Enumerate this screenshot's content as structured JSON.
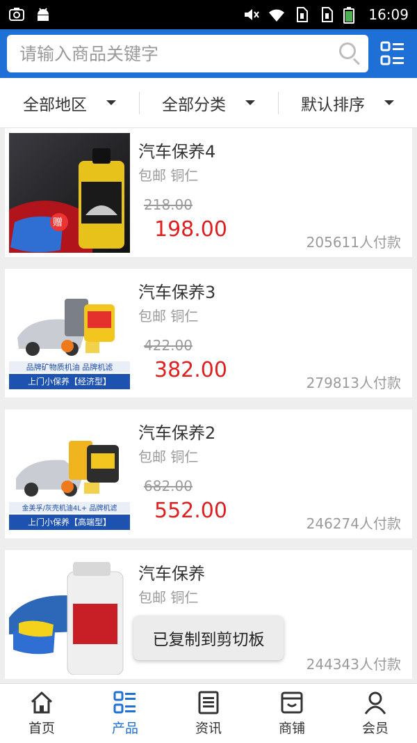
{
  "status_bar": {
    "left_icons": [
      "screenshot-icon",
      "android-icon"
    ],
    "right_icons": [
      "mute-icon",
      "wifi-icon",
      "sim1-icon",
      "sim2-icon",
      "battery-icon"
    ],
    "time": "16:09"
  },
  "header": {
    "search_placeholder": "请输入商品关键字",
    "search_icon": "search-icon",
    "menu_icon": "list-menu-icon"
  },
  "filters": [
    {
      "label": "全部地区"
    },
    {
      "label": "全部分类"
    },
    {
      "label": "默认排序"
    }
  ],
  "products": [
    {
      "title": "汽车保养4",
      "sub": "包邮 铜仁",
      "old_price": "218.00",
      "price": "198.00",
      "sold": "205611人付款"
    },
    {
      "title": "汽车保养3",
      "sub": "包邮 铜仁",
      "old_price": "422.00",
      "price": "382.00",
      "sold": "279813人付款"
    },
    {
      "title": "汽车保养2",
      "sub": "包邮 铜仁",
      "old_price": "682.00",
      "price": "552.00",
      "sold": "246274人付款"
    },
    {
      "title": "汽车保养",
      "sub": "包邮 铜仁",
      "old_price": "",
      "price": "",
      "sold": "244343人付款"
    }
  ],
  "thumb_text": {
    "p0_tag": "赠",
    "p1_line1": "品牌矿物质机油 品牌机滤",
    "p1_line2": "上门小保养【经济型】",
    "p2_line1": "金美孚/灰壳机油4L+ 品牌机滤",
    "p2_line2": "上门小保养【高端型】"
  },
  "toast": "已复制到剪切板",
  "bottom_nav": [
    {
      "label": "首页",
      "icon": "home-icon",
      "active": false
    },
    {
      "label": "产品",
      "icon": "product-list-icon",
      "active": true
    },
    {
      "label": "资讯",
      "icon": "news-icon",
      "active": false
    },
    {
      "label": "商铺",
      "icon": "shop-icon",
      "active": false
    },
    {
      "label": "会员",
      "icon": "member-icon",
      "active": false
    }
  ],
  "colors": {
    "primary": "#1e6fd6",
    "price": "#e02020",
    "muted": "#9a9a9a"
  }
}
